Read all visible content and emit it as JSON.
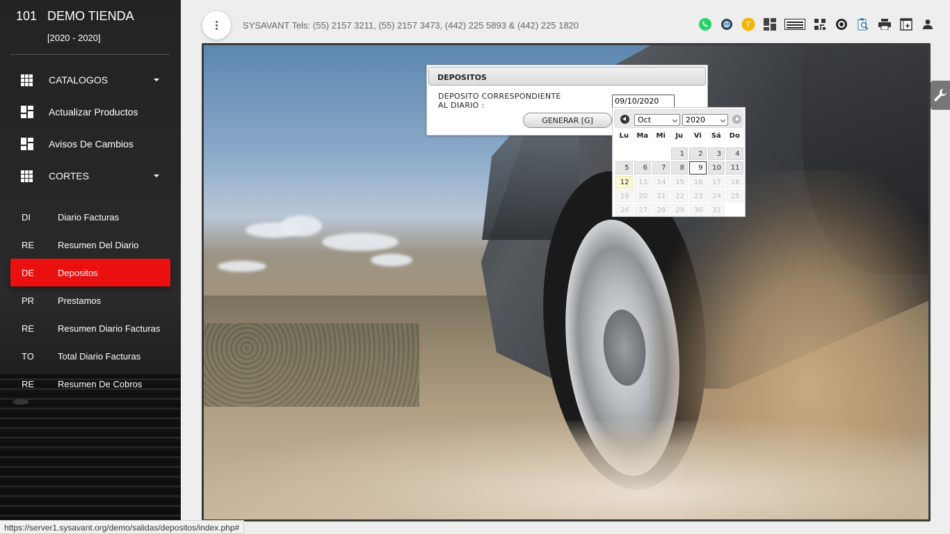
{
  "sidebar": {
    "store_number": "101",
    "store_name": "DEMO TIENDA",
    "years": "[2020 - 2020]",
    "menu": [
      {
        "label": "CATALOGOS",
        "icon": "grid-icon",
        "has_caret": true
      },
      {
        "label": "Actualizar Productos",
        "icon": "dashboard-icon",
        "has_caret": false
      },
      {
        "label": "Avisos De Cambios",
        "icon": "dashboard-icon",
        "has_caret": false
      },
      {
        "label": "CORTES",
        "icon": "grid-icon",
        "has_caret": true
      }
    ],
    "sub_items": [
      {
        "abbr": "DI",
        "label": "Diario Facturas",
        "active": false
      },
      {
        "abbr": "RE",
        "label": "Resumen Del Diario",
        "active": false
      },
      {
        "abbr": "DE",
        "label": "Depositos",
        "active": true
      },
      {
        "abbr": "PR",
        "label": "Prestamos",
        "active": false
      },
      {
        "abbr": "RE",
        "label": "Resumen Diario Facturas",
        "active": false
      },
      {
        "abbr": "TO",
        "label": "Total Diario Facturas",
        "active": false
      },
      {
        "abbr": "RE",
        "label": "Resumen De Cobros",
        "active": false
      }
    ],
    "active_color": "#ea1010"
  },
  "topbar": {
    "tel_text": "SYSAVANT Tels: (55) 2157 3211, (55) 2157 3473, (442) 225 5893 & (442) 225 1820",
    "icons": [
      "whatsapp-icon",
      "support-agent-icon",
      "t-badge-icon",
      "dashboard-icon",
      "keyboard-icon",
      "qr-code-icon",
      "target-icon",
      "clipboard-search-icon",
      "printer-icon",
      "add-window-icon",
      "user-icon"
    ],
    "t_badge_letter": "T",
    "whatsapp_color": "#25d366",
    "t_badge_color": "#f5b400"
  },
  "dialog": {
    "title": "DEPOSITOS",
    "label_line1": "DEPOSITO CORRESPONDIENTE",
    "label_line2": "AL DIARIO :",
    "date_value": "09/10/2020",
    "generate_label": "GENERAR [G]"
  },
  "datepicker": {
    "month": "Oct",
    "year": "2020",
    "weekdays": [
      "Lu",
      "Ma",
      "Mi",
      "Ju",
      "Vi",
      "Sá",
      "Do"
    ],
    "leading_blanks": 3,
    "days_in_month": 31,
    "last_enabled_day": 12,
    "selected_day": 9,
    "today_day": 12
  },
  "status_url": "https://server1.sysavant.org/demo/salidas/depositos/index.php#"
}
